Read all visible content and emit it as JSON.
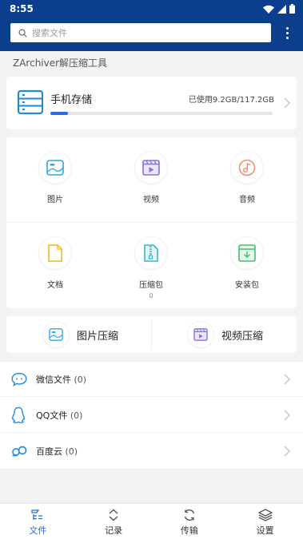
{
  "status_bar": {
    "time": "8:55"
  },
  "search": {
    "placeholder": "搜索文件"
  },
  "app_title": "ZArchiver解压缩工具",
  "storage": {
    "name": "手机存储",
    "usage_text": "已使用9.2GB/117.2GB",
    "used_fraction": 0.078
  },
  "categories": [
    {
      "label": "图片",
      "icon": "image-icon",
      "color": "#2ea8d6"
    },
    {
      "label": "视频",
      "icon": "video-icon",
      "color": "#8c6fe0"
    },
    {
      "label": "音频",
      "icon": "music-icon",
      "color": "#f08a6a"
    },
    {
      "label": "文档",
      "icon": "document-icon",
      "color": "#f2c12e"
    },
    {
      "label": "压缩包",
      "sub": "0",
      "icon": "archive-icon",
      "color": "#38b7c9"
    },
    {
      "label": "安装包",
      "icon": "install-package-icon",
      "color": "#4cbb6f"
    }
  ],
  "compress": [
    {
      "label": "图片压缩",
      "icon": "image-icon"
    },
    {
      "label": "视频压缩",
      "icon": "video-icon"
    }
  ],
  "sources": [
    {
      "label": "微信文件",
      "count": "(0)",
      "icon": "wechat-icon"
    },
    {
      "label": "QQ文件",
      "count": "(0)",
      "icon": "qq-icon"
    },
    {
      "label": "百度云",
      "count": "(0)",
      "icon": "baidu-cloud-icon"
    }
  ],
  "bottom_nav": [
    {
      "label": "文件",
      "icon": "files-icon",
      "active": true
    },
    {
      "label": "记录",
      "icon": "history-icon",
      "active": false
    },
    {
      "label": "传输",
      "icon": "transfer-icon",
      "active": false
    },
    {
      "label": "设置",
      "icon": "settings-icon",
      "active": false
    }
  ],
  "colors": {
    "header": "#0b3e8c",
    "accent": "#2a6be0",
    "background": "#f2f3f5"
  }
}
